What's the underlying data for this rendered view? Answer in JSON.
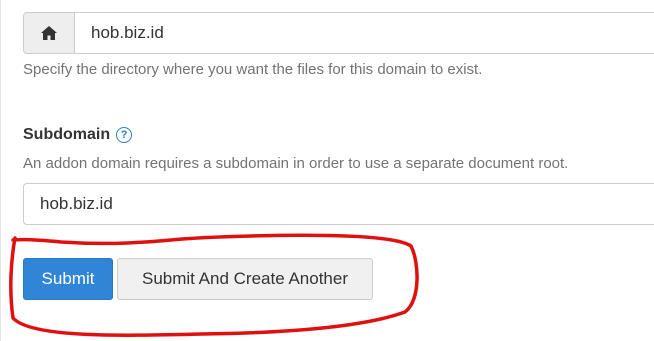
{
  "docroot": {
    "icon": "home-icon",
    "value": "hob.biz.id",
    "help": "Specify the directory where you want the files for this domain to exist."
  },
  "subdomain": {
    "label": "Subdomain",
    "help_icon": "?",
    "help": "An addon domain requires a subdomain in order to use a separate document root.",
    "value": "hob.biz.id"
  },
  "actions": {
    "submit_label": "Submit",
    "submit_another_label": "Submit And Create Another"
  },
  "colors": {
    "primary": "#2f86d6",
    "annotation": "#e01010"
  }
}
